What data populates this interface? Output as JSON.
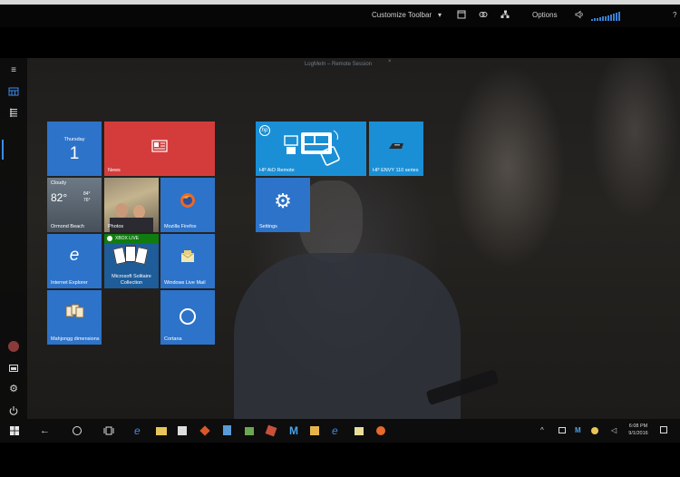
{
  "toolbar": {
    "customize_label": "Customize Toolbar",
    "options_label": "Options",
    "help_label": "?"
  },
  "session": {
    "title": "LogMeIn – Remote Session"
  },
  "tiles": {
    "calendar": {
      "day_name": "Thursday",
      "day_number": "1"
    },
    "news": {
      "label": "News"
    },
    "weather": {
      "condition": "Cloudy",
      "temp": "82°",
      "high": "84°",
      "low": "76°",
      "location": "Ormond Beach"
    },
    "photos": {
      "label": "Photos"
    },
    "firefox": {
      "label": "Mozilla Firefox"
    },
    "ie": {
      "label": "Internet Explorer"
    },
    "solitaire": {
      "badge": "XBOX LIVE",
      "label": "Microsoft Solitaire Collection"
    },
    "mail": {
      "label": "Windows Live Mail"
    },
    "mahjong": {
      "label": "Mahjongg dimensions"
    },
    "cortana": {
      "label": "Cortana"
    },
    "hp_remote": {
      "label": "HP AiO Remote"
    },
    "hp_printer": {
      "label": "HP ENVY 110 series"
    },
    "settings": {
      "label": "Settings"
    }
  },
  "taskbar": {
    "time": "6:08 PM",
    "date": "9/1/2016"
  },
  "colors": {
    "tile_blue": "#2d73c9",
    "tile_red": "#d43c3c",
    "accent": "#3c8ce8"
  }
}
